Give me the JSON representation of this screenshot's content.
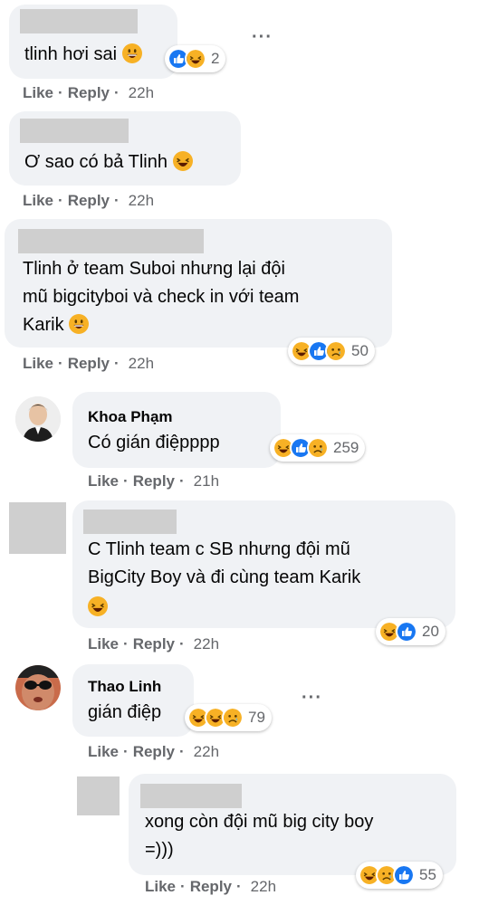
{
  "actions": {
    "like": "Like",
    "reply": "Reply",
    "sep": "·"
  },
  "comments": [
    {
      "text": "tlinh hơi sai",
      "time": "22h",
      "reactions": "2"
    },
    {
      "text": "Ơ sao có bả Tlinh",
      "time": "22h"
    },
    {
      "lines": [
        "Tlinh ở team Suboi nhưng lại đội",
        "mũ bigcityboi và check in với team",
        "Karik"
      ],
      "time": "22h",
      "reactions": "50"
    },
    {
      "name": "Khoa Phạm",
      "text": "Có gián điệpppp",
      "time": "21h",
      "reactions": "259"
    },
    {
      "lines": [
        "C Tlinh team c SB nhưng đội mũ",
        "BigCity Boy và đi cùng team Karik"
      ],
      "time": "22h",
      "reactions": "20"
    },
    {
      "name": "Thao Linh",
      "text": "gián điệp",
      "time": "22h",
      "reactions": "79"
    },
    {
      "lines": [
        "xong còn đội mũ big city boy",
        "=)))"
      ],
      "time": "22h",
      "reactions": "55"
    }
  ],
  "colors": {
    "bubble": "#f0f2f5",
    "meta": "#65676b",
    "like_blue": "#1877f2",
    "emoji_yellow": "#f7b125",
    "redaction": "#cfcfcf"
  },
  "icons": [
    "haha-emoji-icon",
    "like-reaction-icon",
    "sad-emoji-icon",
    "grinning-emoji-icon",
    "more-options-icon"
  ]
}
